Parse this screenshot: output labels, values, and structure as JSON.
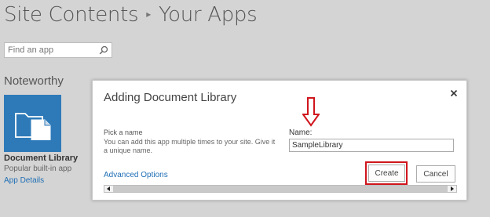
{
  "breadcrumb": {
    "parent": "Site Contents",
    "current": "Your Apps"
  },
  "search": {
    "placeholder": "Find an app",
    "icon": "magnifier-icon"
  },
  "noteworthy": {
    "title": "Noteworthy",
    "app": {
      "name": "Document Library",
      "subtitle": "Popular built-in app",
      "details_link": "App Details",
      "tile_color": "#2e7ab8",
      "icon": "document-library-icon"
    }
  },
  "dialog": {
    "title": "Adding Document Library",
    "close_icon": "close-icon",
    "pick_label": "Pick a name",
    "pick_description": "You can add this app multiple times to your site. Give it a unique name.",
    "name_label": "Name:",
    "name_value": "SampleLibrary",
    "advanced_options": "Advanced Options",
    "create_label": "Create",
    "cancel_label": "Cancel",
    "annotation_color": "#d0151c",
    "link_color": "#1f6fb5"
  }
}
